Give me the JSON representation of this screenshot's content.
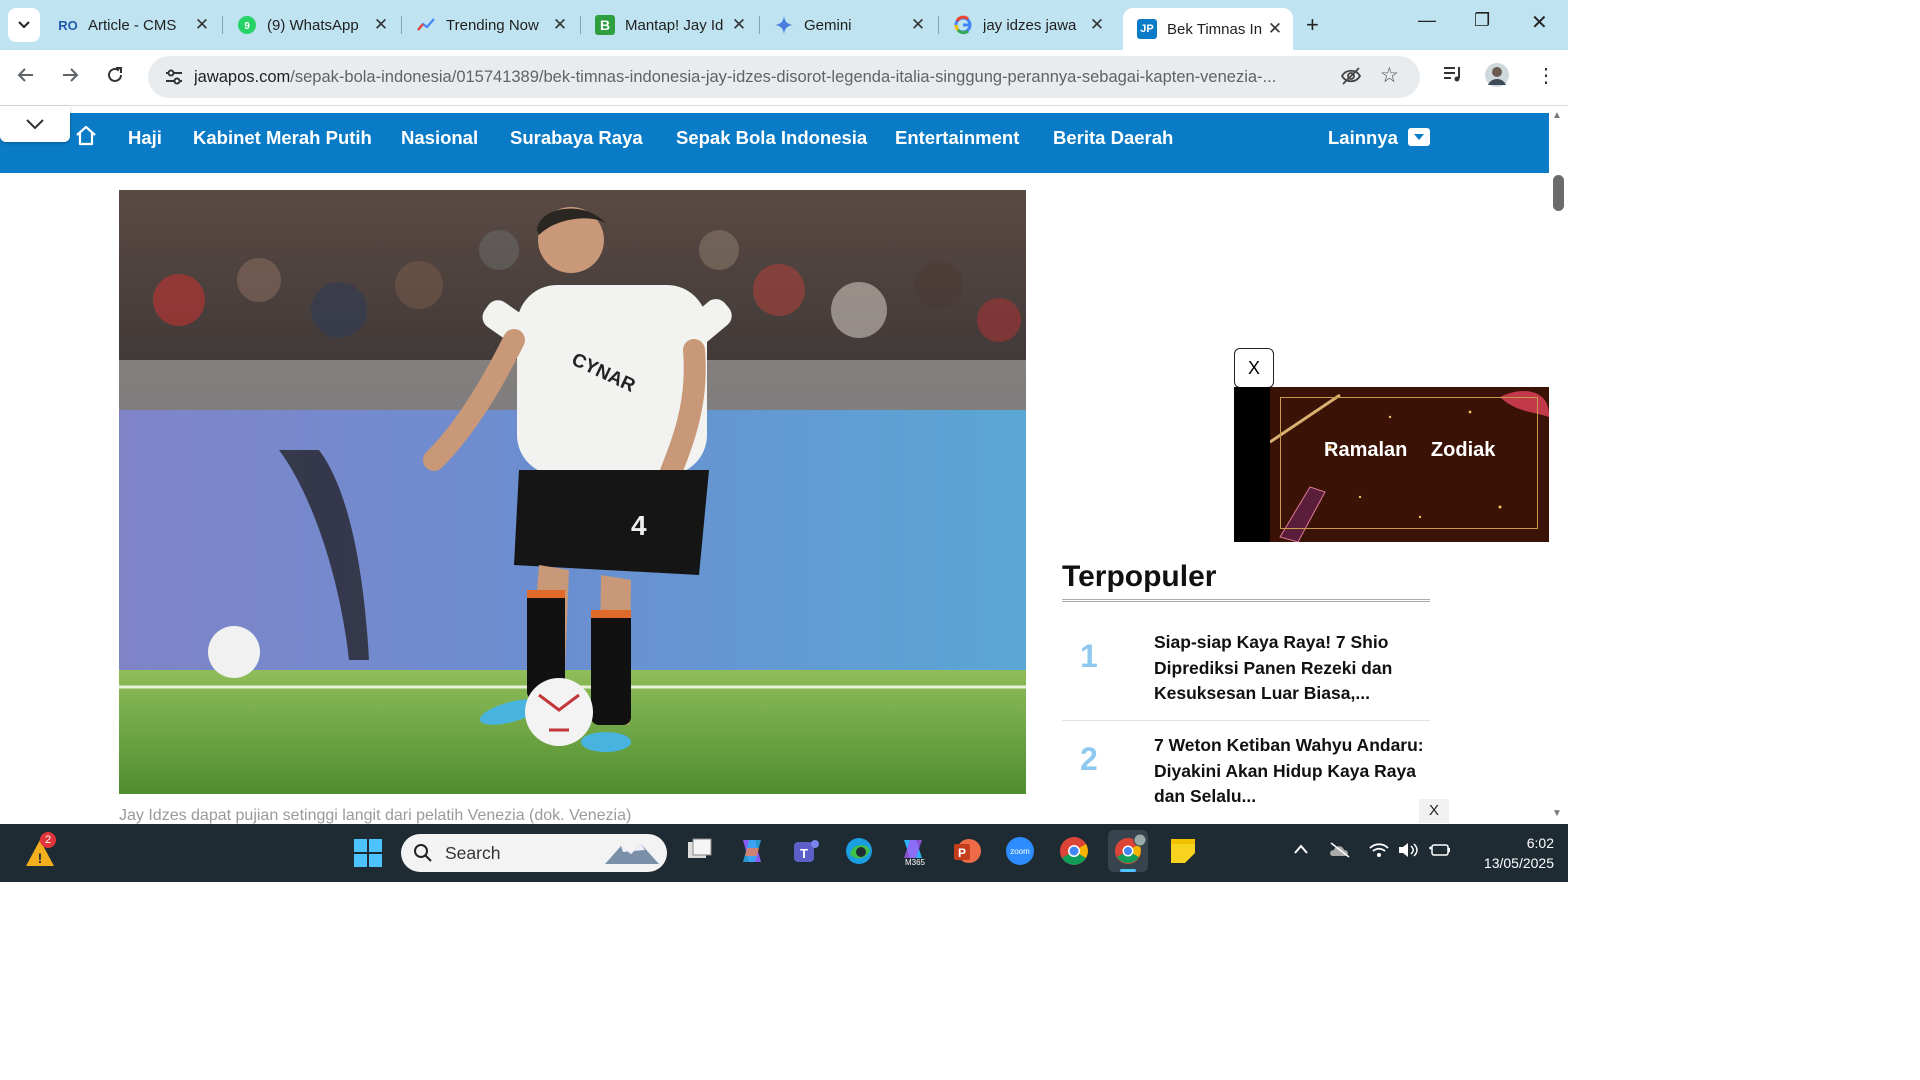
{
  "browser": {
    "tabs": [
      {
        "title": "Article - CMS",
        "active": false
      },
      {
        "title": "(9) WhatsApp",
        "active": false
      },
      {
        "title": "Trending Now",
        "active": false
      },
      {
        "title": "Mantap! Jay Id",
        "active": false
      },
      {
        "title": "Gemini",
        "active": false
      },
      {
        "title": "jay idzes jawa",
        "active": false
      },
      {
        "title": "Bek Timnas In",
        "active": true
      }
    ],
    "url_domain": "jawapos.com",
    "url_path": "/sepak-bola-indonesia/015741389/bek-timnas-indonesia-jay-idzes-disorot-legenda-italia-singgung-perannya-sebagai-kapten-venezia-..."
  },
  "site_nav": {
    "items": [
      "Haji",
      "Kabinet Merah Putih",
      "Nasional",
      "Surabaya Raya",
      "Sepak Bola Indonesia",
      "Entertainment",
      "Berita Daerah"
    ],
    "more_label": "Lainnya"
  },
  "article": {
    "image_caption": "Jay Idzes dapat pujian setinggi langit dari pelatih Venezia (dok. Venezia)",
    "jersey_sponsor": "CYNAR",
    "jersey_number": "4"
  },
  "sidebar": {
    "ad_close_label": "X",
    "ad_text": "Ramalan Zodiak",
    "popular_heading": "Terpopuler",
    "popular": [
      {
        "rank": "1",
        "title": "Siap-siap Kaya Raya! 7 Shio Diprediksi Panen Rezeki dan Kesuksesan Luar Biasa,..."
      },
      {
        "rank": "2",
        "title": "7 Weton Ketiban Wahyu Andaru: Diyakini Akan Hidup Kaya Raya dan Selalu..."
      }
    ],
    "sticky_close_label": "X"
  },
  "taskbar": {
    "search_placeholder": "Search",
    "notification_count": "2",
    "time": "6:02",
    "date": "13/05/2025",
    "zoom_label": "zoom",
    "m365_label": "M365"
  }
}
